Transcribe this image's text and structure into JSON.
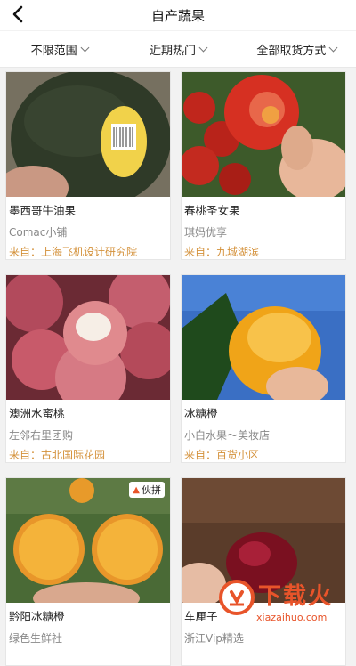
{
  "header": {
    "back_icon": "chevron-left-icon",
    "title": "自产蔬果"
  },
  "filters": [
    {
      "label": "不限范围"
    },
    {
      "label": "近期热门"
    },
    {
      "label": "全部取货方式"
    }
  ],
  "products": [
    {
      "name": "墨西哥牛油果",
      "shop": "Comac小铺",
      "from": "来自：上海飞机设计研究院",
      "image": "avocado-photo"
    },
    {
      "name": "春桃圣女果",
      "shop": "琪妈优享",
      "from": "来自：九城湖滨",
      "image": "tomato-photo"
    },
    {
      "name": "澳洲水蜜桃",
      "shop": "左邻右里团购",
      "from": "来自：古北国际花园",
      "image": "peach-photo"
    },
    {
      "name": "冰糖橙",
      "shop": "小白水果～美妆店",
      "from": "来自：百货小区",
      "image": "orange-photo"
    },
    {
      "name": "黔阳冰糖橙",
      "shop": "绿色生鲜社",
      "from": "",
      "image": "orange-halves-photo",
      "badge": "伙拼"
    },
    {
      "name": "车厘子",
      "shop": "浙江Vip精选",
      "from": "",
      "image": "cherry-photo"
    }
  ],
  "watermark": {
    "text": "下载火",
    "url": "xiazaihuo.com"
  }
}
